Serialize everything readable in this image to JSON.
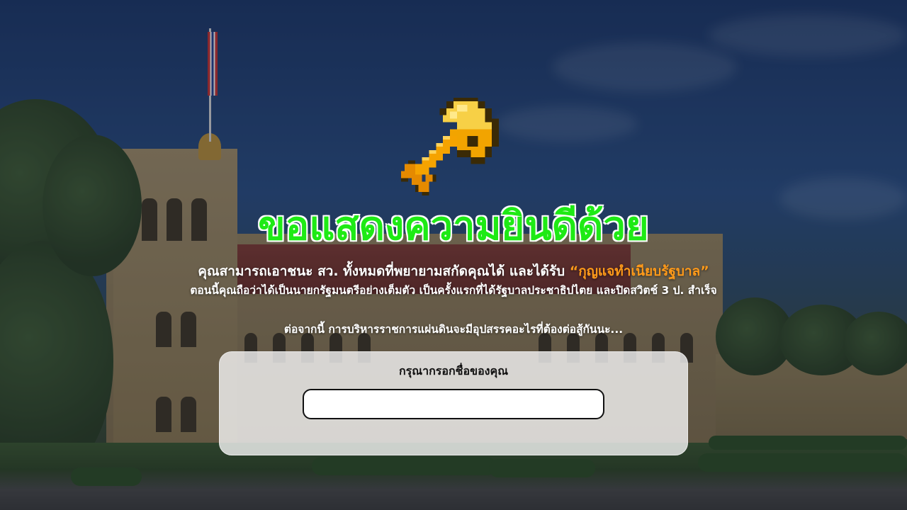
{
  "congrats": {
    "headline": "ขอแสดงความยินดีด้วย",
    "line1_main": "คุณสามารถเอาชนะ สว. ทั้งหมดที่พยายามสกัดคุณได้ และได้รับ ",
    "line1_highlight": "“กุญแจทำเนียบรัฐบาล”",
    "line2": "ตอนนี้คุณถือว่าได้เป็นนายกรัฐมนตรีอย่างเต็มตัว เป็นครั้งแรกที่ได้รัฐบาลประชาธิปไตย และปิดสวิตช์ 3 ป. สำเร็จ",
    "line3": "ต่อจากนี้ การบริหารราชการแผ่นดินจะมีอุปสรรคอะไรที่ต้องต่อสู้กันนะ..."
  },
  "name_form": {
    "label": "กรุณากรอกชื่อของคุณ",
    "value": "",
    "placeholder": ""
  },
  "icons": {
    "reward": "golden-key-icon"
  },
  "colors": {
    "headline_green": "#1eea15",
    "highlight_orange": "#ff9a1a",
    "key_gold": "#f5a300"
  }
}
